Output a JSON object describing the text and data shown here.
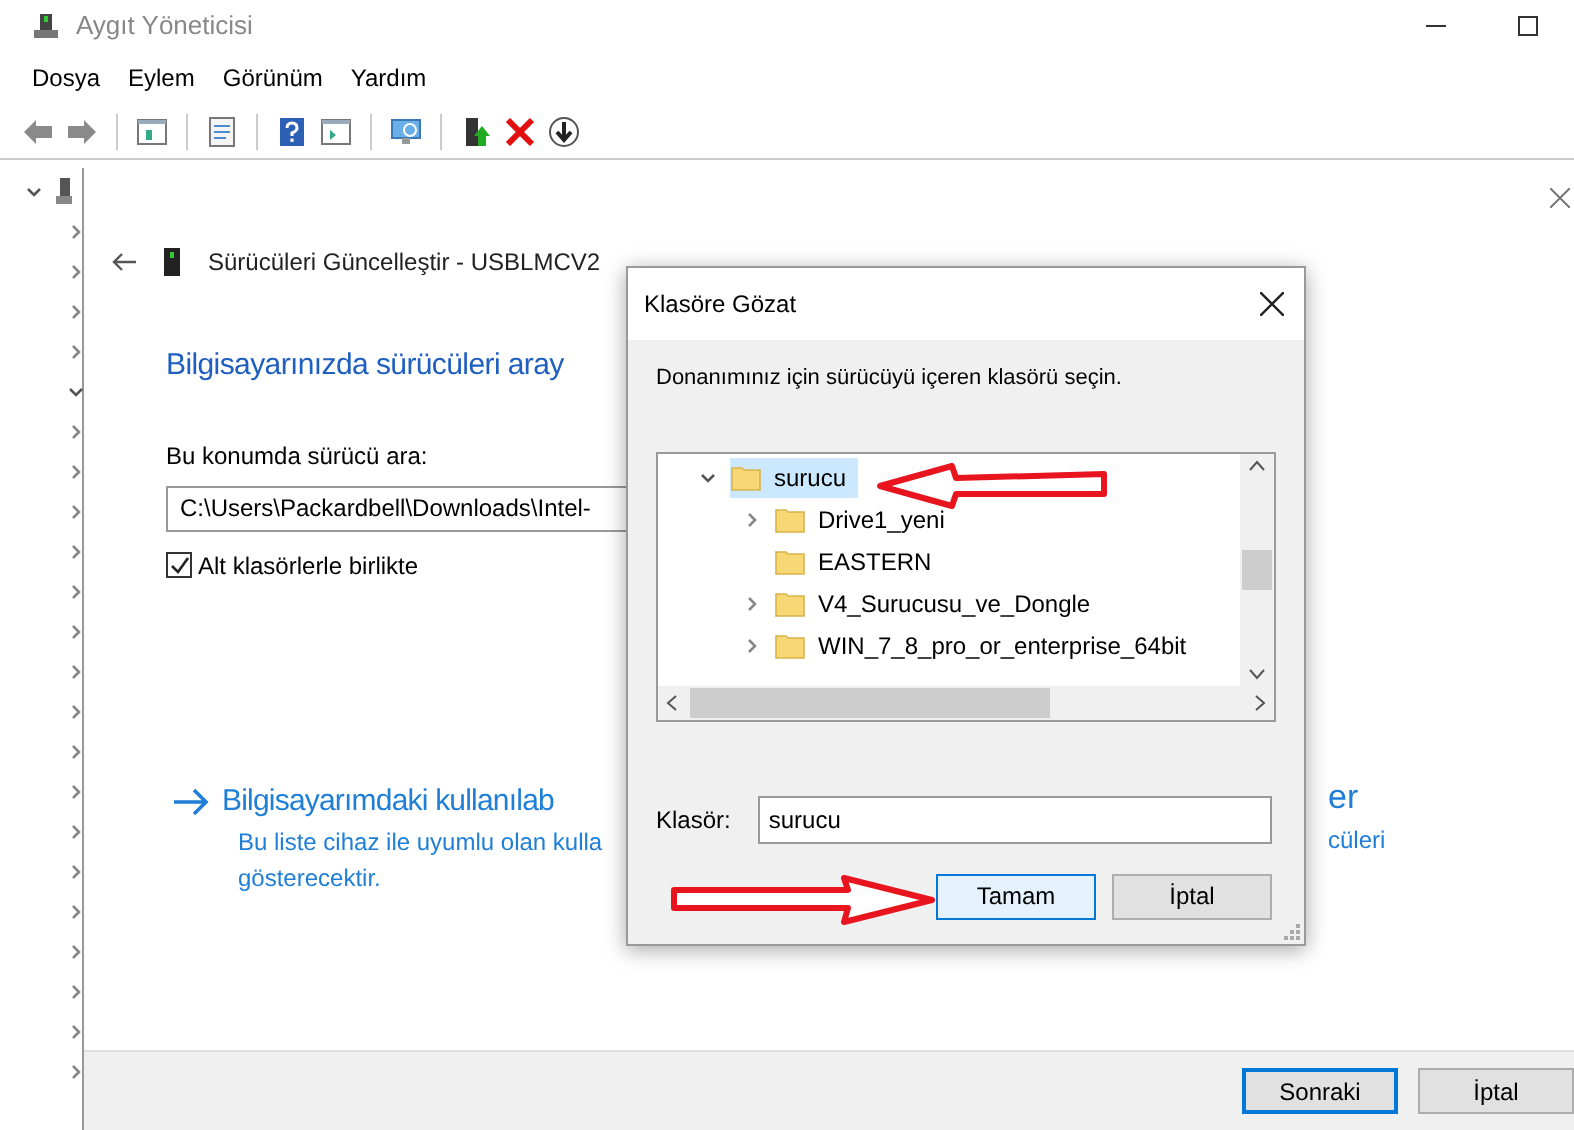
{
  "window": {
    "title": "Aygıt Yöneticisi"
  },
  "menu": [
    "Dosya",
    "Eylem",
    "Görünüm",
    "Yardım"
  ],
  "device_tree": [
    {
      "expanded": true
    },
    {
      "expanded": false
    },
    {
      "expanded": false
    },
    {
      "expanded": false
    },
    {
      "expanded": false
    },
    {
      "expanded": true
    },
    {
      "expanded": false
    },
    {
      "expanded": false
    },
    {
      "expanded": false
    },
    {
      "expanded": false
    },
    {
      "expanded": false
    },
    {
      "expanded": false
    },
    {
      "expanded": false
    },
    {
      "expanded": false
    },
    {
      "expanded": false
    },
    {
      "expanded": false
    },
    {
      "expanded": false
    },
    {
      "expanded": false
    },
    {
      "expanded": false
    },
    {
      "expanded": false
    },
    {
      "expanded": false
    },
    {
      "expanded": false
    },
    {
      "expanded": false
    }
  ],
  "wizard": {
    "title": "Sürücüleri Güncelleştir - USBLMCV2",
    "heading": "Bilgisayarınızda sürücüleri aray",
    "search_label": "Bu konumda sürücü ara:",
    "path_value": "C:\\Users\\Packardbell\\Downloads\\Intel-",
    "include_subfolders": {
      "label": "Alt klasörlerle birlikte",
      "checked": true
    },
    "link": {
      "text_left": "Bilgisayarımdaki kullanılab",
      "text_right": "er"
    },
    "description": {
      "line1_left": "Bu liste cihaz ile uyumlu olan kulla",
      "line1_right": "cüleri",
      "line2": "gösterecektir."
    },
    "buttons": [
      {
        "label": "Sonraki",
        "focused": true
      },
      {
        "label": "İptal",
        "focused": false
      }
    ]
  },
  "dialog": {
    "title": "Klasöre Gözat",
    "instruction": "Donanımınız için sürücüyü içeren klasörü seçin.",
    "tree": [
      {
        "label": "surucu",
        "expanded": true,
        "selected": true,
        "children": [
          {
            "label": "Drive1_yeni",
            "has_children": true,
            "selected": false
          },
          {
            "label": "EASTERN",
            "has_children": false,
            "selected": false
          },
          {
            "label": "V4_Surucusu_ve_Dongle",
            "has_children": true,
            "selected": false
          },
          {
            "label": "WIN_7_8_pro_or_enterprise_64bit",
            "has_children": true,
            "selected": false
          }
        ]
      }
    ],
    "folder_label": "Klasör:",
    "folder_value": "surucu",
    "buttons": [
      {
        "label": "Tamam",
        "focused": true
      },
      {
        "label": "İptal",
        "focused": false
      }
    ]
  }
}
